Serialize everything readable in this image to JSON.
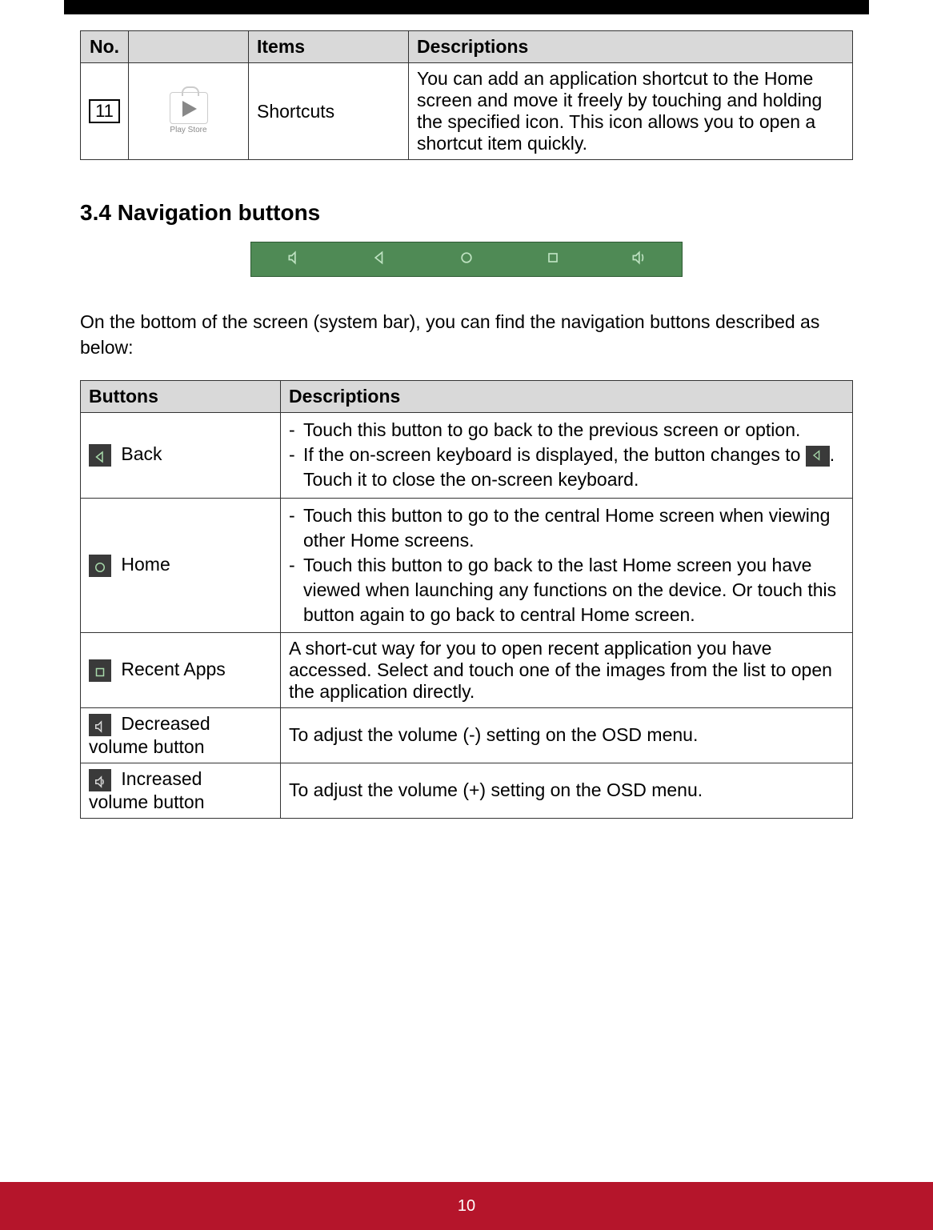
{
  "page_number": "10",
  "table1": {
    "headers": {
      "no": "No.",
      "items": "Items",
      "desc": "Descriptions"
    },
    "row": {
      "no": "11",
      "icon_caption": "Play Store",
      "item": "Shortcuts",
      "desc": "You can add an application shortcut to the Home screen and move it freely by touching and holding the specified icon. This icon allows you to open a shortcut item quickly."
    }
  },
  "section_title": "3.4  Navigation buttons",
  "intro": "On the bottom of the screen (system bar), you can find the navigation buttons described as below:",
  "table2": {
    "headers": {
      "buttons": "Buttons",
      "desc": "Descriptions"
    },
    "rows": {
      "back": {
        "label": " Back",
        "d1": "Touch this button to go back to the previous screen or option.",
        "d2a": "If the on-screen keyboard is displayed, the button changes to ",
        "d2b": ". Touch it to close the on-screen keyboard."
      },
      "home": {
        "label": " Home",
        "d1": "Touch this button to go to the central Home screen when viewing other Home screens.",
        "d2": "Touch this button to go back to the last Home screen you have viewed when launching any functions on the device. Or touch this button again to go back to central Home screen."
      },
      "recent": {
        "label": " Recent Apps",
        "desc": "A short-cut way for you to open recent application you have accessed. Select and touch one of the images from the list to open the application directly."
      },
      "voldown": {
        "label_a": " Decreased",
        "label_b": "volume button",
        "desc": "To adjust the volume (-) setting on the OSD menu."
      },
      "volup": {
        "label_a": " Increased",
        "label_b": "volume button",
        "desc": "To adjust the volume (+) setting on the OSD menu."
      }
    }
  }
}
